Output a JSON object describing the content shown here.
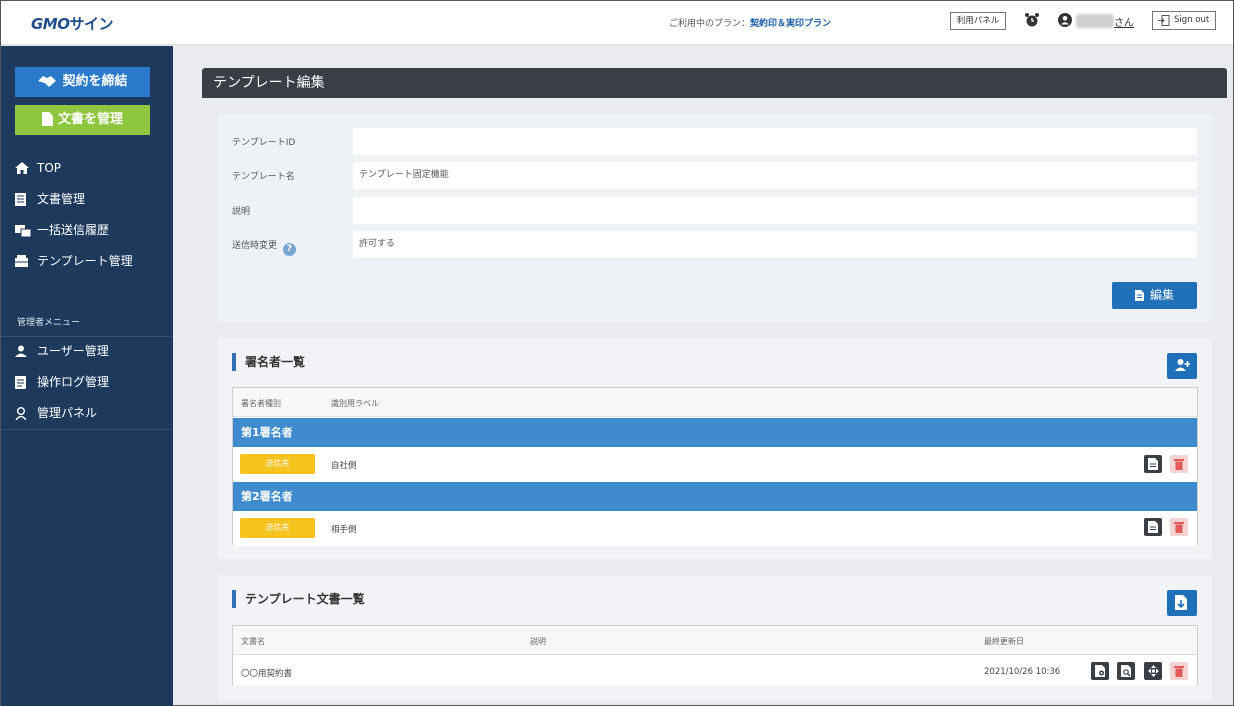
{
  "header": {
    "logo_main": "GMO",
    "logo_sub": "サイン",
    "plan_prefix": "ご利用中のプラン：",
    "plan_name": "契約印＆実印プラン",
    "usage_panel": "利用パネル",
    "user_suffix": "さん",
    "signout": "Sign out"
  },
  "sidebar": {
    "cta_contract": "契約を締結",
    "cta_manage": "文書を管理",
    "items": [
      {
        "label": "TOP",
        "icon": "home-icon"
      },
      {
        "label": "文書管理",
        "icon": "document-list-icon"
      },
      {
        "label": "一括送信履歴",
        "icon": "batch-send-icon"
      },
      {
        "label": "テンプレート管理",
        "icon": "template-icon"
      }
    ],
    "admin_heading": "管理者メニュー",
    "admin_items": [
      {
        "label": "ユーザー管理",
        "icon": "user-icon"
      },
      {
        "label": "操作ログ管理",
        "icon": "log-icon"
      },
      {
        "label": "管理パネル",
        "icon": "admin-panel-icon"
      }
    ]
  },
  "page": {
    "title": "テンプレート編集"
  },
  "form": {
    "fields": [
      {
        "label": "テンプレートID",
        "value": ""
      },
      {
        "label": "テンプレート名",
        "value": "テンプレート固定機能"
      },
      {
        "label": "説明",
        "value": ""
      },
      {
        "label": "送信時変更",
        "value": "許可する"
      }
    ],
    "help_mark": "?",
    "edit_button": "編集"
  },
  "signers": {
    "title": "署名者一覧",
    "columns": [
      "署名者種別",
      "識別用ラベル"
    ],
    "rows": [
      {
        "heading": "第1署名者",
        "badge": "送信先",
        "label": "自社側"
      },
      {
        "heading": "第2署名者",
        "badge": "送信先",
        "label": "相手側"
      }
    ]
  },
  "documents": {
    "title": "テンプレート文書一覧",
    "columns": [
      "文書名",
      "説明",
      "最終更新日"
    ],
    "rows": [
      {
        "name": "〇〇用契約書",
        "description": "",
        "updated": "2021/10/26 10:36"
      }
    ]
  },
  "colors": {
    "sidebar": "#1d3a5c",
    "accent_blue": "#2a7ac9",
    "accent_green": "#8dc63f",
    "signer_header": "#3f8bcd",
    "badge_yellow": "#f6c21c"
  }
}
